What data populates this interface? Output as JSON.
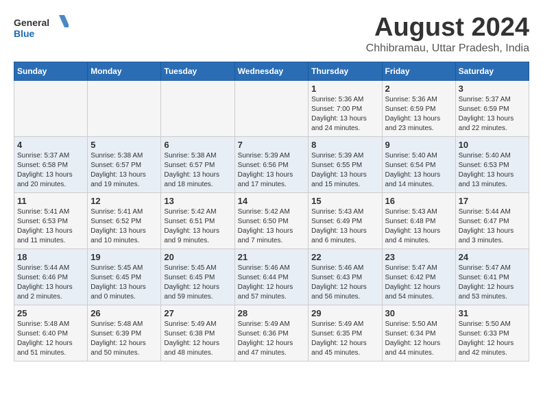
{
  "header": {
    "logo_general": "General",
    "logo_blue": "Blue",
    "title": "August 2024",
    "subtitle": "Chhibramau, Uttar Pradesh, India"
  },
  "calendar": {
    "days_of_week": [
      "Sunday",
      "Monday",
      "Tuesday",
      "Wednesday",
      "Thursday",
      "Friday",
      "Saturday"
    ],
    "weeks": [
      [
        {
          "day": "",
          "info": ""
        },
        {
          "day": "",
          "info": ""
        },
        {
          "day": "",
          "info": ""
        },
        {
          "day": "",
          "info": ""
        },
        {
          "day": "1",
          "info": "Sunrise: 5:36 AM\nSunset: 7:00 PM\nDaylight: 13 hours and 24 minutes."
        },
        {
          "day": "2",
          "info": "Sunrise: 5:36 AM\nSunset: 6:59 PM\nDaylight: 13 hours and 23 minutes."
        },
        {
          "day": "3",
          "info": "Sunrise: 5:37 AM\nSunset: 6:59 PM\nDaylight: 13 hours and 22 minutes."
        }
      ],
      [
        {
          "day": "4",
          "info": "Sunrise: 5:37 AM\nSunset: 6:58 PM\nDaylight: 13 hours and 20 minutes."
        },
        {
          "day": "5",
          "info": "Sunrise: 5:38 AM\nSunset: 6:57 PM\nDaylight: 13 hours and 19 minutes."
        },
        {
          "day": "6",
          "info": "Sunrise: 5:38 AM\nSunset: 6:57 PM\nDaylight: 13 hours and 18 minutes."
        },
        {
          "day": "7",
          "info": "Sunrise: 5:39 AM\nSunset: 6:56 PM\nDaylight: 13 hours and 17 minutes."
        },
        {
          "day": "8",
          "info": "Sunrise: 5:39 AM\nSunset: 6:55 PM\nDaylight: 13 hours and 15 minutes."
        },
        {
          "day": "9",
          "info": "Sunrise: 5:40 AM\nSunset: 6:54 PM\nDaylight: 13 hours and 14 minutes."
        },
        {
          "day": "10",
          "info": "Sunrise: 5:40 AM\nSunset: 6:53 PM\nDaylight: 13 hours and 13 minutes."
        }
      ],
      [
        {
          "day": "11",
          "info": "Sunrise: 5:41 AM\nSunset: 6:53 PM\nDaylight: 13 hours and 11 minutes."
        },
        {
          "day": "12",
          "info": "Sunrise: 5:41 AM\nSunset: 6:52 PM\nDaylight: 13 hours and 10 minutes."
        },
        {
          "day": "13",
          "info": "Sunrise: 5:42 AM\nSunset: 6:51 PM\nDaylight: 13 hours and 9 minutes."
        },
        {
          "day": "14",
          "info": "Sunrise: 5:42 AM\nSunset: 6:50 PM\nDaylight: 13 hours and 7 minutes."
        },
        {
          "day": "15",
          "info": "Sunrise: 5:43 AM\nSunset: 6:49 PM\nDaylight: 13 hours and 6 minutes."
        },
        {
          "day": "16",
          "info": "Sunrise: 5:43 AM\nSunset: 6:48 PM\nDaylight: 13 hours and 4 minutes."
        },
        {
          "day": "17",
          "info": "Sunrise: 5:44 AM\nSunset: 6:47 PM\nDaylight: 13 hours and 3 minutes."
        }
      ],
      [
        {
          "day": "18",
          "info": "Sunrise: 5:44 AM\nSunset: 6:46 PM\nDaylight: 13 hours and 2 minutes."
        },
        {
          "day": "19",
          "info": "Sunrise: 5:45 AM\nSunset: 6:45 PM\nDaylight: 13 hours and 0 minutes."
        },
        {
          "day": "20",
          "info": "Sunrise: 5:45 AM\nSunset: 6:45 PM\nDaylight: 12 hours and 59 minutes."
        },
        {
          "day": "21",
          "info": "Sunrise: 5:46 AM\nSunset: 6:44 PM\nDaylight: 12 hours and 57 minutes."
        },
        {
          "day": "22",
          "info": "Sunrise: 5:46 AM\nSunset: 6:43 PM\nDaylight: 12 hours and 56 minutes."
        },
        {
          "day": "23",
          "info": "Sunrise: 5:47 AM\nSunset: 6:42 PM\nDaylight: 12 hours and 54 minutes."
        },
        {
          "day": "24",
          "info": "Sunrise: 5:47 AM\nSunset: 6:41 PM\nDaylight: 12 hours and 53 minutes."
        }
      ],
      [
        {
          "day": "25",
          "info": "Sunrise: 5:48 AM\nSunset: 6:40 PM\nDaylight: 12 hours and 51 minutes."
        },
        {
          "day": "26",
          "info": "Sunrise: 5:48 AM\nSunset: 6:39 PM\nDaylight: 12 hours and 50 minutes."
        },
        {
          "day": "27",
          "info": "Sunrise: 5:49 AM\nSunset: 6:38 PM\nDaylight: 12 hours and 48 minutes."
        },
        {
          "day": "28",
          "info": "Sunrise: 5:49 AM\nSunset: 6:36 PM\nDaylight: 12 hours and 47 minutes."
        },
        {
          "day": "29",
          "info": "Sunrise: 5:49 AM\nSunset: 6:35 PM\nDaylight: 12 hours and 45 minutes."
        },
        {
          "day": "30",
          "info": "Sunrise: 5:50 AM\nSunset: 6:34 PM\nDaylight: 12 hours and 44 minutes."
        },
        {
          "day": "31",
          "info": "Sunrise: 5:50 AM\nSunset: 6:33 PM\nDaylight: 12 hours and 42 minutes."
        }
      ]
    ]
  }
}
